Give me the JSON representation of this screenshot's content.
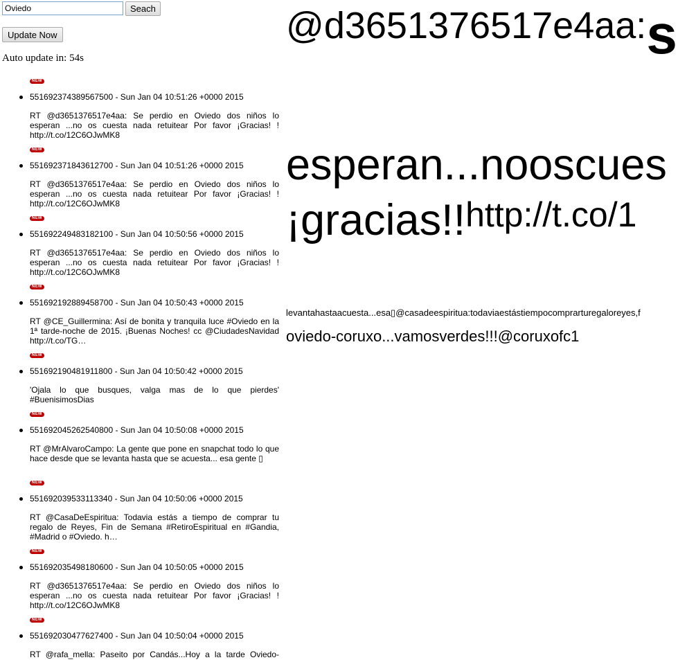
{
  "search": {
    "value": "Oviedo",
    "button_label": "Seach"
  },
  "update_button_label": "Update Now",
  "auto_update": "Auto update in: 54s",
  "new_badge": "NEW",
  "tweets": [
    {
      "header": "551692374389567500 - Sun Jan 04 10:51:26 +0000 2015",
      "text": "RT @d3651376517e4aa: Se perdio en Oviedo dos niños lo esperan ...no os cuesta nada retuitear Por favor ¡Gracias! ! http://t.co/12C6OJwMK8"
    },
    {
      "header": "551692371843612700 - Sun Jan 04 10:51:26 +0000 2015",
      "text": "RT @d3651376517e4aa: Se perdio en Oviedo dos niños lo esperan ...no os cuesta nada retuitear Por favor ¡Gracias! ! http://t.co/12C6OJwMK8"
    },
    {
      "header": "551692249483182100 - Sun Jan 04 10:50:56 +0000 2015",
      "text": "RT @d3651376517e4aa: Se perdio en Oviedo dos niños lo esperan ...no os cuesta nada retuitear Por favor ¡Gracias! ! http://t.co/12C6OJwMK8"
    },
    {
      "header": "551692192889458700 - Sun Jan 04 10:50:43 +0000 2015",
      "text": "RT @CE_Guillermina: Así de bonita y tranquila luce #Oviedo en la 1ª tarde-noche de 2015. ¡Buenas Noches! cc @CiudadesNavidad http://t.co/TG…"
    },
    {
      "header": "551692190481911800 - Sun Jan 04 10:50:42 +0000 2015",
      "text": "'Ojala lo que busques, valga mas de lo que pierdes' #BuenisimosDias"
    },
    {
      "header": "551692045262540800 - Sun Jan 04 10:50:08 +0000 2015",
      "text": "RT @MrAlvaroCampo: La gente que pone en snapchat todo lo que hace desde que se levanta hasta que se acuesta... esa gente ▯"
    },
    {
      "header": "551692039533113340 - Sun Jan 04 10:50:06 +0000 2015",
      "text": "RT @CasaDeEspiritua: Todavia estás a tiempo de comprar tu regalo de Reyes, Fin de Semana #RetiroEspiritual en #Gandia, #Madrid o #Oviedo. h…"
    },
    {
      "header": "551692035498180600 - Sun Jan 04 10:50:05 +0000 2015",
      "text": "RT @d3651376517e4aa: Se perdio en Oviedo dos niños lo esperan ...no os cuesta nada retuitear Por favor ¡Gracias! ! http://t.co/12C6OJwMK8"
    },
    {
      "header": "551692030477627400 - Sun Jan 04 10:50:04 +0000 2015",
      "text": "RT @rafa_mella: Paseito por Candás...Hoy a la tarde Oviedo-Coruxo... Vamos verdes !!! @CoruxoFC1 @Coruxo_VAVEL"
    }
  ],
  "word_cloud": {
    "line1": "@d3651376517e4aa:",
    "line1_tail": "s",
    "line2": "esperan...nooscues",
    "line3_big": "¡gracias!!",
    "line3_small": "http://t.co/1",
    "line4": "levantahastaacuesta...esa▯@casadeespiritua:todaviaestástiempocomprarturegaloreyes,f",
    "line5": "oviedo-coruxo...vamosverdes!!!@coruxofc1"
  }
}
